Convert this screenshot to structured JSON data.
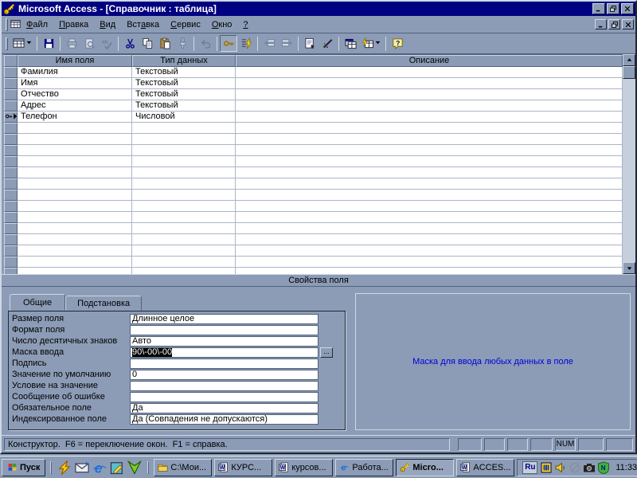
{
  "window": {
    "title": "Microsoft Access - [Справочник : таблица]"
  },
  "menu": {
    "items": [
      {
        "label": "Файл",
        "u": 0
      },
      {
        "label": "Правка",
        "u": 0
      },
      {
        "label": "Вид",
        "u": 0
      },
      {
        "label": "Вставка",
        "u": 3
      },
      {
        "label": "Сервис",
        "u": 0
      },
      {
        "label": "Окно",
        "u": 0
      },
      {
        "label": "?",
        "u": 0
      }
    ]
  },
  "toolbar": {
    "groups": [
      {
        "buttons": [
          {
            "icon": "table-view-icon",
            "dropdown": true
          }
        ]
      },
      {
        "buttons": [
          {
            "icon": "save-icon"
          }
        ]
      },
      {
        "buttons": [
          {
            "icon": "print-icon",
            "disabled": true
          },
          {
            "icon": "print-preview-icon",
            "disabled": true
          },
          {
            "icon": "spelling-icon",
            "disabled": true
          }
        ]
      },
      {
        "buttons": [
          {
            "icon": "cut-icon"
          },
          {
            "icon": "copy-icon"
          },
          {
            "icon": "paste-icon"
          },
          {
            "icon": "format-painter-icon",
            "disabled": true
          }
        ]
      },
      {
        "buttons": [
          {
            "icon": "undo-icon",
            "disabled": true
          }
        ]
      },
      {
        "buttons": [
          {
            "icon": "primary-key-icon",
            "pressed": true
          },
          {
            "icon": "indexes-icon"
          }
        ]
      },
      {
        "buttons": [
          {
            "icon": "insert-rows-icon",
            "disabled": true
          },
          {
            "icon": "delete-rows-icon",
            "disabled": true
          }
        ]
      },
      {
        "buttons": [
          {
            "icon": "properties-icon"
          },
          {
            "icon": "build-icon"
          }
        ]
      },
      {
        "buttons": [
          {
            "icon": "database-window-icon"
          },
          {
            "icon": "new-object-icon",
            "dropdown": true
          }
        ]
      },
      {
        "buttons": [
          {
            "icon": "help-icon"
          }
        ]
      }
    ]
  },
  "grid": {
    "columns": [
      "Имя поля",
      "Тип данных",
      "Описание"
    ],
    "rows": [
      {
        "name": "Фамилия",
        "type": "Текстовый",
        "desc": "",
        "primary_key": false
      },
      {
        "name": "Имя",
        "type": "Текстовый",
        "desc": "",
        "primary_key": false
      },
      {
        "name": "Отчество",
        "type": "Текстовый",
        "desc": "",
        "primary_key": false
      },
      {
        "name": "Адрес",
        "type": "Текстовый",
        "desc": "",
        "primary_key": false
      },
      {
        "name": "Телефон",
        "type": "Числовой",
        "desc": "",
        "primary_key": true
      }
    ],
    "empty_rows": 14
  },
  "properties_caption": "Свойства поля",
  "properties": {
    "tabs": [
      {
        "label": "Общие",
        "active": true
      },
      {
        "label": "Подстановка",
        "active": false
      }
    ],
    "builder_label": "...",
    "rows": [
      {
        "label": "Размер поля",
        "value": "Длинное целое"
      },
      {
        "label": "Формат поля",
        "value": ""
      },
      {
        "label": "Число десятичных знаков",
        "value": "Авто"
      },
      {
        "label": "Маска ввода",
        "value": "90\\-00\\-00",
        "selected": true,
        "builder": true
      },
      {
        "label": "Подпись",
        "value": ""
      },
      {
        "label": "Значение по умолчанию",
        "value": "0"
      },
      {
        "label": "Условие на значение",
        "value": ""
      },
      {
        "label": "Сообщение об ошибке",
        "value": ""
      },
      {
        "label": "Обязательное поле",
        "value": "Да"
      },
      {
        "label": "Индексированное поле",
        "value": "Да (Совпадения не допускаются)"
      }
    ],
    "help_text": "Маска для ввода любых данных в поле"
  },
  "status_bar": {
    "message": "Конструктор.  F6 = переключение окон.  F1 = справка.",
    "indicators": [
      "",
      "",
      "",
      "",
      "NUM",
      "",
      ""
    ]
  },
  "taskbar": {
    "start_label": "Пуск",
    "quick_launch": [
      "winamp-lightning-icon",
      "mail-icon",
      "ie-icon",
      "editor-icon",
      "download-v-icon"
    ],
    "buttons": [
      {
        "label": "C:\\Мои...",
        "icon": "folder-icon",
        "active": false
      },
      {
        "label": "КУРС...",
        "icon": "word-icon",
        "active": false
      },
      {
        "label": "курсов...",
        "icon": "word-icon",
        "active": false
      },
      {
        "label": "Работа...",
        "icon": "ie-icon",
        "active": false
      },
      {
        "label": "Micro...",
        "icon": "access-key-icon",
        "active": true
      },
      {
        "label": "ACCES...",
        "icon": "word-icon",
        "active": false
      }
    ],
    "tray": {
      "lang": "Ru",
      "icons": [
        "monitor-icon",
        "speaker-icon",
        "dialup-icon",
        "camera-icon",
        "shield-icon"
      ],
      "time": "11:33"
    }
  }
}
